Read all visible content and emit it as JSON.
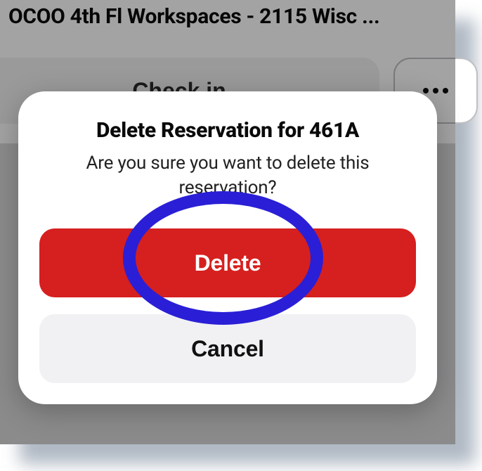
{
  "header": {
    "title": "OCOO 4th Fl Workspaces - 2115 Wisc ..."
  },
  "actions": {
    "checkin_label": "Check in",
    "more_label": "..."
  },
  "dialog": {
    "title": "Delete Reservation for 461A",
    "message": "Are you sure you want to delete this reservation?",
    "delete_label": "Delete",
    "cancel_label": "Cancel"
  },
  "annotation": {
    "highlight_color": "#2a1fd6"
  }
}
